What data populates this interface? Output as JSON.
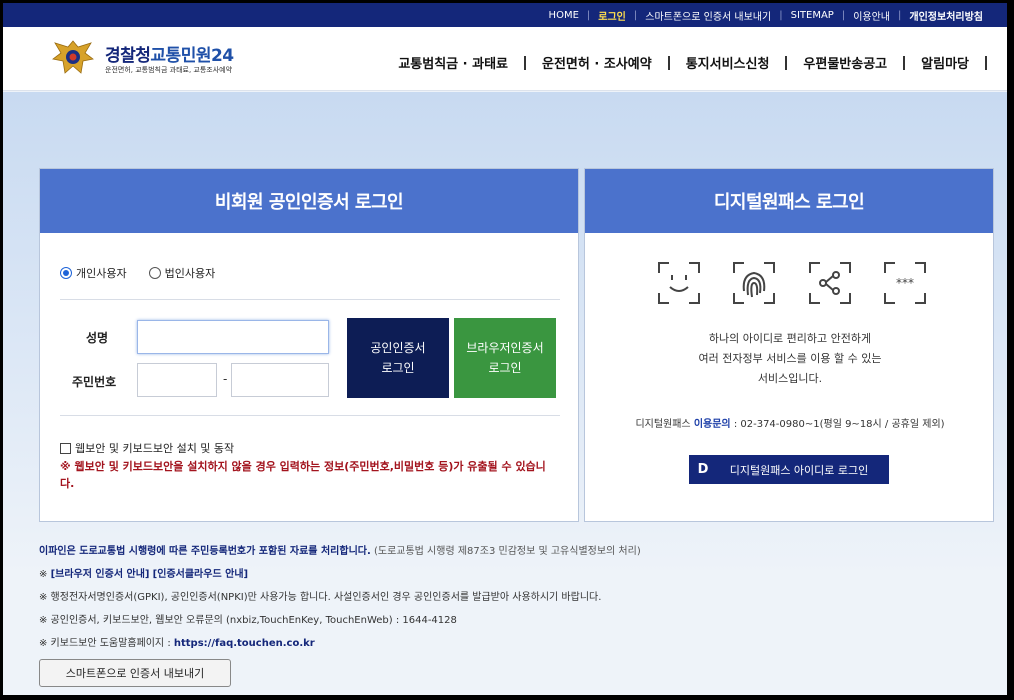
{
  "topbar": {
    "links": [
      "HOME",
      "로그인",
      "스마트폰으로 인증서 내보내기",
      "SITEMAP",
      "이용안내",
      "개인정보처리방침"
    ]
  },
  "header": {
    "logo_title_main": "경찰청",
    "logo_title_accent": "교통민원24",
    "logo_sub": "운전면허, 교통범칙금 과태료, 교통조사예약",
    "nav": [
      "교통범칙금 · 과태료",
      "운전면허 · 조사예약",
      "통지서비스신청",
      "우편물반송공고",
      "알림마당"
    ]
  },
  "left_panel": {
    "title": "비회원 공인인증서 로그인",
    "radio_personal": "개인사용자",
    "radio_corporate": "법인사용자",
    "name_label": "성명",
    "rrn_label": "주민번호",
    "rrn_dash": "-",
    "cert_btn_line1": "공인인증서",
    "cert_btn_line2": "로그인",
    "browser_btn_line1": "브라우저인증서",
    "browser_btn_line2": "로그인",
    "security_check": "웹보안 및 키보드보안 설치 및 동작",
    "warning": "※ 웹보안 및 키보드보안을 설치하지 않을 경우 입력하는 정보(주민번호,비밀번호 등)가 유출될 수 있습니다."
  },
  "right_panel": {
    "title": "디지털원패스 로그인",
    "desc_line1": "하나의 아이디로 편리하고 안전하게",
    "desc_line2": "여러 전자정부 서비스를 이용 할 수 있는",
    "desc_line3": "서비스입니다.",
    "contact_prefix": "디지털원패스",
    "contact_highlight": "이용문의",
    "contact_rest": ": 02-374-0980~1(평일 9~18시 / 공휴일 제외)",
    "btn_letter": "D",
    "btn_label": "디지털원패스 아이디로 로그인"
  },
  "notes": {
    "line1_bold": "이파인은 도로교통법 시행령에 따른 주민등록번호가 포함된 자료를 처리합니다.",
    "line1_rest": "(도로교통법 시행령 제87조3 민감정보 및 고유식별정보의 처리)",
    "line2_prefix": "※",
    "line2_link1": "[브라우저 인증서 안내]",
    "line2_link2": "[인증서클라우드 안내]",
    "line3": "※ 행정전자서명인증서(GPKI), 공인인증서(NPKI)만 사용가능 합니다. 사설인증서인 경우 공인인증서를 발급받아 사용하시기 바랍니다.",
    "line4": "※ 공인인증서, 키보드보안, 웹보안 오류문의 (nxbiz,TouchEnKey, TouchEnWeb) : 1644-4128",
    "line5_prefix": "※ 키보드보안 도움말홈페이지 :",
    "line5_link": "https://faq.touchen.co.kr",
    "export_btn": "스마트폰으로 인증서 내보내기"
  },
  "colors": {
    "topbar": "#14277a",
    "panel_header": "#4b72cc",
    "cert_button": "#0d1d55",
    "browser_button": "#3a9640",
    "warning": "#a3141e"
  }
}
